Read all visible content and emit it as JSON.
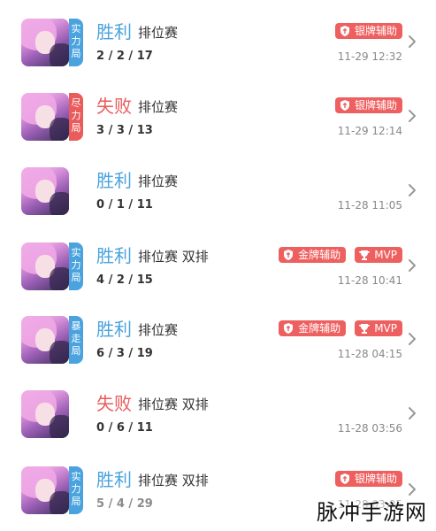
{
  "matches": [
    {
      "badge": "实力局",
      "badge_color": "#4aa3df",
      "result": "胜利",
      "result_type": "win",
      "mode": "排位赛",
      "kda": "2 / 2 / 17",
      "tags": [
        {
          "icon": "silver-support-icon",
          "label": "银牌辅助"
        }
      ],
      "time": "11-29 12:32"
    },
    {
      "badge": "尽力局",
      "badge_color": "#ea5b5b",
      "result": "失败",
      "result_type": "loss",
      "mode": "排位赛",
      "kda": "3 / 3 / 13",
      "tags": [
        {
          "icon": "silver-support-icon",
          "label": "银牌辅助"
        }
      ],
      "time": "11-29 12:14"
    },
    {
      "badge": "",
      "badge_color": "",
      "result": "胜利",
      "result_type": "win",
      "mode": "排位赛",
      "kda": "0 / 1 / 11",
      "tags": [],
      "time": "11-28 11:05"
    },
    {
      "badge": "实力局",
      "badge_color": "#4aa3df",
      "result": "胜利",
      "result_type": "win",
      "mode": "排位赛 双排",
      "kda": "4 / 2 / 15",
      "tags": [
        {
          "icon": "gold-support-icon",
          "label": "金牌辅助"
        },
        {
          "icon": "mvp-trophy-icon",
          "label": "MVP"
        }
      ],
      "time": "11-28 10:41"
    },
    {
      "badge": "暴走局",
      "badge_color": "#4aa3df",
      "result": "胜利",
      "result_type": "win",
      "mode": "排位赛",
      "kda": "6 / 3 / 19",
      "tags": [
        {
          "icon": "gold-support-icon",
          "label": "金牌辅助"
        },
        {
          "icon": "mvp-trophy-icon",
          "label": "MVP"
        }
      ],
      "time": "11-28 04:15"
    },
    {
      "badge": "",
      "badge_color": "",
      "result": "失败",
      "result_type": "loss",
      "mode": "排位赛 双排",
      "kda": "0 / 6 / 11",
      "tags": [],
      "time": "11-28 03:56"
    },
    {
      "badge": "实力局",
      "badge_color": "#4aa3df",
      "result": "胜利",
      "result_type": "win",
      "mode": "排位赛 双排",
      "kda": "5 / 4 / 29",
      "tags": [
        {
          "icon": "silver-support-icon",
          "label": "银牌辅助"
        }
      ],
      "time": "11-28 03:05"
    }
  ],
  "colors": {
    "win": "#4aa3df",
    "loss": "#ea5b5b",
    "tag": "#ee6060",
    "chevron": "#999999"
  },
  "watermark": "脉冲手游网"
}
